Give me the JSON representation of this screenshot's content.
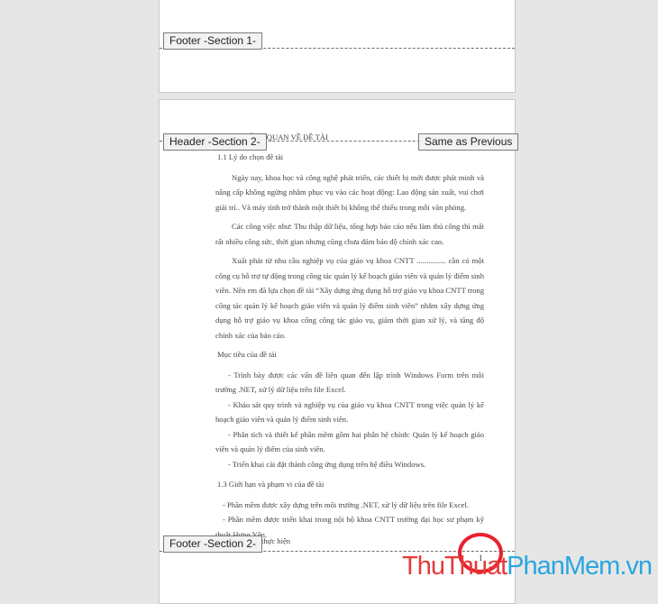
{
  "section1": {
    "footer_label": "Footer -Section 1-"
  },
  "section2": {
    "header_label": "Header -Section 2-",
    "same_as_previous_label": "Same as Previous",
    "header_text": "ỔNG QUAN VỀ ĐỀ TÀI",
    "footer_label": "Footer -Section 2-",
    "footer_cut_text": "thực hiện",
    "page_number": "1"
  },
  "document": {
    "paragraphs": [
      "1.1 Lý do chọn đề tài",
      "Ngày nay, khoa học và công nghệ phát triển, các thiết bị mới được phát minh và nâng cấp không ngừng nhằm phục vụ vào các hoạt động: Lao động sản xuất, vui chơi giải trí.. Và máy tính trở thành một thiết bị không thể thiếu trong mỗi văn phòng.",
      "Các công việc như: Thu thập dữ liệu, tổng hợp báo cáo nếu làm thủ công thì mất rất nhiều công sức, thời gian nhưng cũng chưa đảm bảo độ chính xác cao.",
      "Xuất phát từ nhu cầu nghiệp vụ của giáo vụ khoa CNTT ............... cần có một công cụ hỗ trợ tự động trong công tác quản lý kế hoạch giáo viên và quản lý điểm sinh viên. Nên em đã lựa chọn đề tài “Xây dựng ứng dụng hỗ trợ giáo vụ khoa CNTT trong công tác quản lý kế hoạch giáo viên và quản lý điểm sinh viên” nhằm xây dựng ứng dụng hỗ trợ giáo vụ khoa cổng công tác giáo vụ, giảm thời gian xử lý, và tăng độ chính xác của báo cáo.",
      "Mục tiêu của đề tài",
      "- Trình bày được các vấn đề liên quan đến lập trình Windows Form trên môi trường .NET, xử lý dữ liệu trên file Excel.",
      "- Khảo sát quy trình và nghiệp vụ của giáo vụ khoa CNTT trong việc quản lý kế hoạch giáo viên và quản lý điểm sinh viên.",
      "- Phân tích và thiết kế phần mềm gồm hai phân hệ chính: Quản lý kế hoạch giáo viên và quản lý điểm của sinh viên.",
      "- Triển khai cài đặt thành công ứng dụng trên hệ điều Windows.",
      "1.3 Giới hạn và phạm vi của đề tài",
      "- Phần mềm được xây dựng trên môi trường .NET, xử lý dữ liệu trên file Excel.",
      "- Phần mềm được triển khai trong nội bộ khoa CNTT trường đại học sư phạm kỹ thuật Hưng Yên."
    ]
  },
  "watermark": {
    "part_a": "ThuThuat",
    "part_b": "PhanMem",
    "part_c": ".vn"
  },
  "colors": {
    "background": "#e6e6e6",
    "page": "#ffffff",
    "circle": "#e8222d",
    "watermark_red": "#e63a3a",
    "watermark_blue": "#2aa6df"
  }
}
